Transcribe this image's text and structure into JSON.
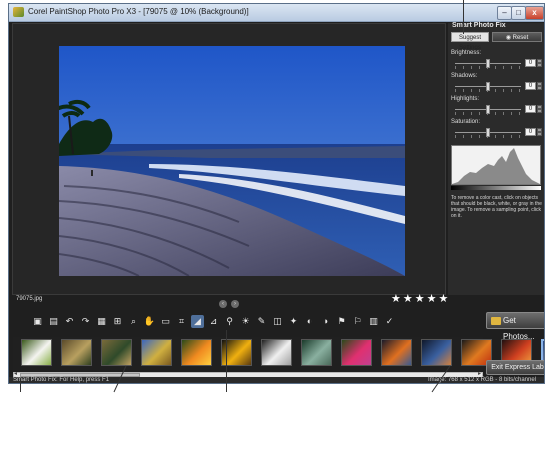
{
  "window": {
    "title": "Corel PaintShop Photo Pro X3 - [79075 @ 10% (Background)]",
    "controls": {
      "minimize": "–",
      "maximize": "□",
      "close": "x"
    }
  },
  "photo": {
    "filename": "79075.jpg"
  },
  "rating": {
    "stars": [
      "★",
      "★",
      "★",
      "★",
      "★"
    ]
  },
  "nav": {
    "prev": "‹",
    "next": "›"
  },
  "toolbar": {
    "tools": [
      {
        "name": "save-icon",
        "glyph": "▣"
      },
      {
        "name": "save-as-icon",
        "glyph": "▤"
      },
      {
        "name": "undo-icon",
        "glyph": "↶"
      },
      {
        "name": "redo-icon",
        "glyph": "↷"
      },
      {
        "name": "actual-size-icon",
        "glyph": "▦"
      },
      {
        "name": "fit-window-icon",
        "glyph": "⊞"
      },
      {
        "name": "zoom-icon",
        "glyph": "⌕"
      },
      {
        "name": "pan-hand-icon",
        "glyph": "✋"
      },
      {
        "name": "info-icon",
        "glyph": "▭"
      },
      {
        "name": "crop-icon",
        "glyph": "⌗"
      },
      {
        "name": "smart-photo-fix-icon",
        "glyph": "◢",
        "selected": true
      },
      {
        "name": "straighten-icon",
        "glyph": "⊿"
      },
      {
        "name": "red-eye-icon",
        "glyph": "⚲"
      },
      {
        "name": "fill-flash-icon",
        "glyph": "☀"
      },
      {
        "name": "makeover-icon",
        "glyph": "✎"
      },
      {
        "name": "depth-of-field-icon",
        "glyph": "◫"
      },
      {
        "name": "object-remover-icon",
        "glyph": "✦"
      },
      {
        "name": "rotate-left-icon",
        "glyph": "◐"
      },
      {
        "name": "rotate-right-icon",
        "glyph": "◑"
      },
      {
        "name": "flag-icon",
        "glyph": "⚑"
      },
      {
        "name": "flag-green-icon",
        "glyph": "⚐"
      },
      {
        "name": "delete-icon",
        "glyph": "▥"
      },
      {
        "name": "edit-icon",
        "glyph": "✓"
      }
    ]
  },
  "thumbnails": [
    {
      "name": "thumb-daisies",
      "colors": [
        "#3a5a1c",
        "#f4f4f0",
        "#8ab04a"
      ]
    },
    {
      "name": "thumb-forest",
      "colors": [
        "#5a4a2a",
        "#b8a060",
        "#304020"
      ]
    },
    {
      "name": "thumb-autumn-tree",
      "colors": [
        "#7a6a3a",
        "#2f4a2a",
        "#c0a060"
      ]
    },
    {
      "name": "thumb-field",
      "colors": [
        "#3a66c0",
        "#d0b040",
        "#7a5a20"
      ]
    },
    {
      "name": "thumb-flowers-orange",
      "colors": [
        "#2a4a1a",
        "#f08a20",
        "#ffd040"
      ]
    },
    {
      "name": "thumb-sunflower",
      "colors": [
        "#101010",
        "#f0b010",
        "#5a3a10"
      ]
    },
    {
      "name": "thumb-white-flower",
      "colors": [
        "#202020",
        "#f0f0f0",
        "#a0a0a0"
      ]
    },
    {
      "name": "thumb-mountains",
      "colors": [
        "#1a3a2a",
        "#8ab0a0",
        "#4a6a5a"
      ]
    },
    {
      "name": "thumb-pink-flowers",
      "colors": [
        "#2a4a1a",
        "#e03070",
        "#c04090"
      ]
    },
    {
      "name": "thumb-sunset-city",
      "colors": [
        "#1a1a2a",
        "#e07020",
        "#3a5a90"
      ]
    },
    {
      "name": "thumb-night-beach",
      "colors": [
        "#10182a",
        "#3a60a0",
        "#d08040"
      ]
    },
    {
      "name": "thumb-dusk",
      "colors": [
        "#1a1a1a",
        "#e07a20",
        "#c03010"
      ]
    },
    {
      "name": "thumb-red-sky",
      "colors": [
        "#201010",
        "#d04020",
        "#f0a040"
      ]
    },
    {
      "name": "thumb-beach-selected",
      "colors": [
        "#2a4a8a",
        "#6a7aa0",
        "#c0c8d0"
      ]
    }
  ],
  "buttons": {
    "get_photos": "Get Photos...",
    "exit_express_lab": "Exit Express Lab"
  },
  "status": {
    "left": "Smart Photo Fix: For Help, press F1",
    "right": "Image: 768 x 512 x RGB - 8 bits/channel"
  },
  "panel": {
    "title": "Smart Photo Fix",
    "tab_suggest": "Suggest Settings",
    "tab_reset": "Reset",
    "sliders": [
      {
        "label": "Brightness:",
        "value": "0",
        "level": 0.5
      },
      {
        "label": "Shadows:",
        "value": "0",
        "level": 0.5
      },
      {
        "label": "Highlights:",
        "value": "0",
        "level": 0.5
      },
      {
        "label": "Saturation:",
        "value": "0",
        "level": 0.5
      }
    ],
    "help": "To remove a color cast, click on objects that should be black, white, or gray in the image. To remove a sampling point, click on it."
  }
}
